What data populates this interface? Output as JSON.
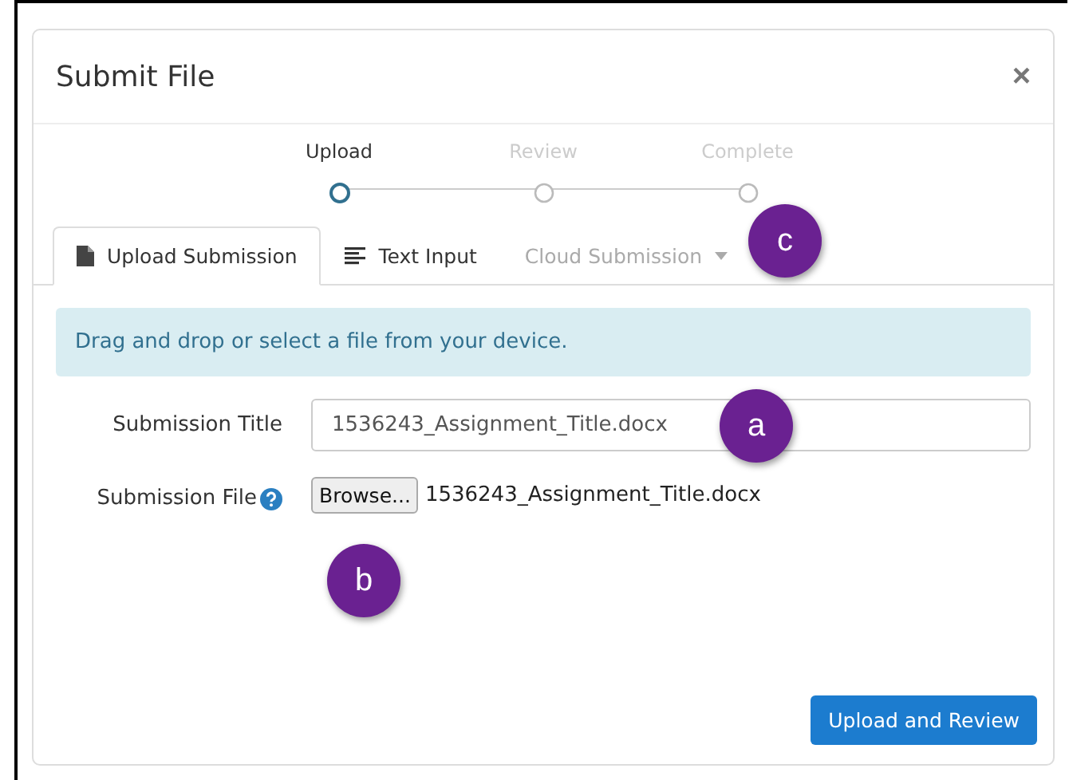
{
  "dialog": {
    "title": "Submit File",
    "close": "×"
  },
  "steps": [
    {
      "label": "Upload",
      "selected": true
    },
    {
      "label": "Review",
      "selected": false
    },
    {
      "label": "Complete",
      "selected": false
    }
  ],
  "tabs": [
    {
      "label": "Upload Submission",
      "kind": "file",
      "selected": true,
      "disabled": false
    },
    {
      "label": "Text Input",
      "kind": "text",
      "selected": false,
      "disabled": false
    },
    {
      "label": "Cloud Submission",
      "kind": "dropdown",
      "selected": false,
      "disabled": true,
      "callout": "c"
    }
  ],
  "alert": "Drag and drop or select a file from your device.",
  "title_field": {
    "label": "Submission Title",
    "value": "1536243_Assignment_Title.docx",
    "callout": "a"
  },
  "file_field": {
    "label": "Submission File",
    "button": "Browse...",
    "file_name": "1536243_Assignment_Title.docx",
    "callout": "b"
  },
  "submit_button": "Upload and Review"
}
